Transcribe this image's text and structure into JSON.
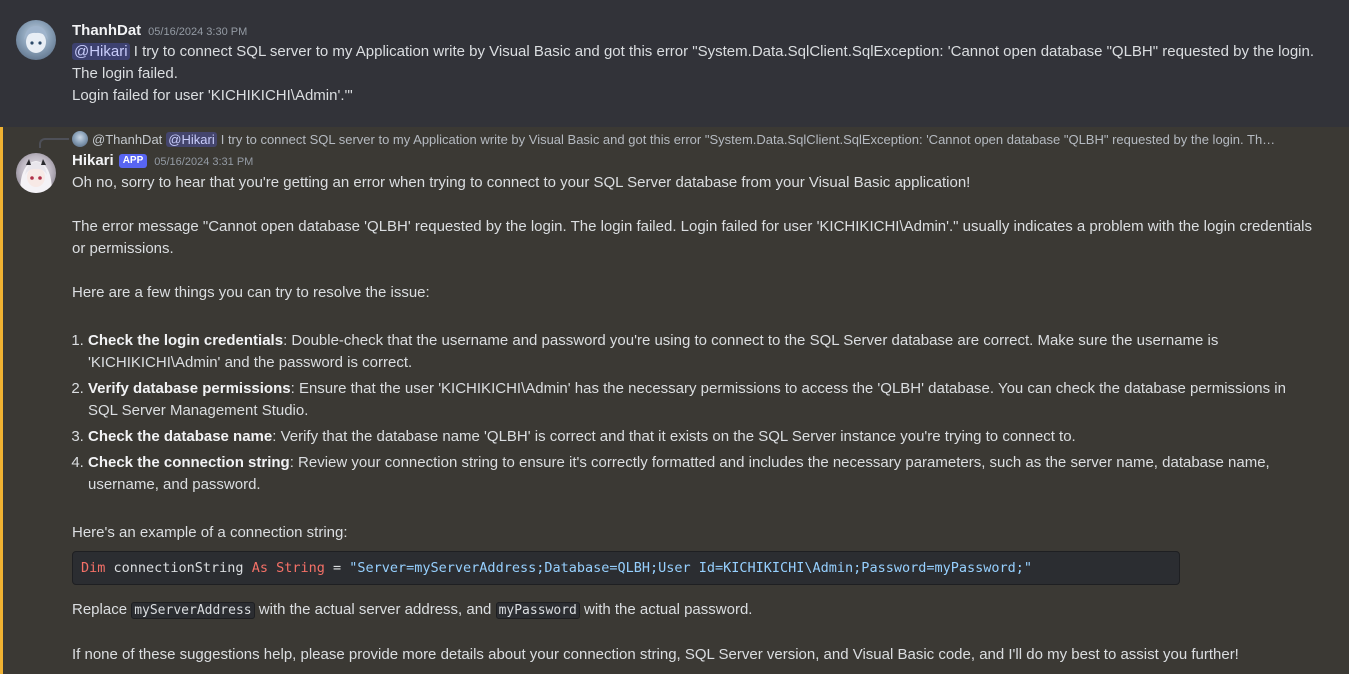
{
  "message1": {
    "username": "ThanhDat",
    "timestamp": "05/16/2024 3:30 PM",
    "mention": "@Hikari",
    "text_line1": " I try to connect SQL server to my Application write by Visual Basic and got this error \"System.Data.SqlClient.SqlException: 'Cannot open database \"QLBH\" requested by the login. The login failed.",
    "text_line2": "Login failed for user 'KICHIKICHI\\Admin'.'\""
  },
  "reply_preview": {
    "username": "@ThanhDat",
    "mention": "@Hikari",
    "text": "I try to connect SQL server to my Application write by Visual Basic and got this error \"System.Data.SqlClient.SqlException: 'Cannot open database \"QLBH\" requested by the login. Th…"
  },
  "message2": {
    "username": "Hikari",
    "badge": "APP",
    "timestamp": "05/16/2024 3:31 PM",
    "intro": "Oh no, sorry to hear that you're getting an error when trying to connect to your SQL Server database from your Visual Basic application!",
    "explanation": "The error message \"Cannot open database 'QLBH' requested by the login. The login failed. Login failed for user 'KICHIKICHI\\Admin'.\" usually indicates a problem with the login credentials or permissions.",
    "lead": "Here are a few things you can try to resolve the issue:",
    "steps": [
      {
        "title": "Check the login credentials",
        "text": ": Double-check that the username and password you're using to connect to the SQL Server database are correct. Make sure the username is 'KICHIKICHI\\Admin' and the password is correct."
      },
      {
        "title": "Verify database permissions",
        "text": ": Ensure that the user 'KICHIKICHI\\Admin' has the necessary permissions to access the 'QLBH' database. You can check the database permissions in SQL Server Management Studio."
      },
      {
        "title": "Check the database name",
        "text": ": Verify that the database name 'QLBH' is correct and that it exists on the SQL Server instance you're trying to connect to."
      },
      {
        "title": "Check the connection string",
        "text": ": Review your connection string to ensure it's correctly formatted and includes the necessary parameters, such as the server name, database name, username, and password."
      }
    ],
    "example_lead": "Here's an example of a connection string:",
    "code": {
      "kw_dim": "Dim",
      "var": " connectionString ",
      "kw_as": "As",
      "kw_string": " String",
      "eq": " = ",
      "str": "\"Server=myServerAddress;Database=QLBH;User Id=KICHIKICHI\\Admin;Password=myPassword;\""
    },
    "replace_1": "Replace ",
    "replace_code1": "myServerAddress",
    "replace_2": " with the actual server address, and ",
    "replace_code2": "myPassword",
    "replace_3": " with the actual password.",
    "closing": "If none of these suggestions help, please provide more details about your connection string, SQL Server version, and Visual Basic code, and I'll do my best to assist you further!"
  },
  "colors": {
    "accent_bar": "#f0b232",
    "app_badge": "#5865f2",
    "mention_bg": "#5865f2"
  }
}
